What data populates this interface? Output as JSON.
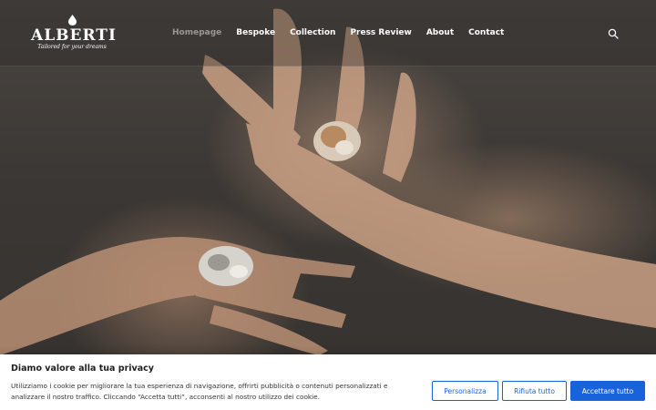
{
  "brand": {
    "name": "ALBERTI",
    "tagline": "Tailored for your dreams"
  },
  "nav": {
    "items": [
      {
        "label": "Homepage",
        "active": true
      },
      {
        "label": "Bespoke",
        "active": false
      },
      {
        "label": "Collection",
        "active": false
      },
      {
        "label": "Press Review",
        "active": false
      },
      {
        "label": "About",
        "active": false
      },
      {
        "label": "Contact",
        "active": false
      }
    ],
    "search_icon": "search-icon"
  },
  "hero": {
    "image": "hands-with-diamond-rings-photo"
  },
  "cookie_banner": {
    "title": "Diamo valore alla tua privacy",
    "text": "Utilizziamo i cookie per migliorare la tua esperienza di navigazione, offrirti pubblicità o contenuti personalizzati e analizzare il nostro traffico. Cliccando “Accetta tutti”, acconsenti al nostro utilizzo dei cookie.",
    "buttons": {
      "customize": "Personalizza",
      "reject": "Rifiuta tutto",
      "accept": "Accettare tutto"
    }
  },
  "colors": {
    "accent": "#1863dc",
    "nav_active": "#9a9795",
    "nav_text": "#ffffff"
  }
}
